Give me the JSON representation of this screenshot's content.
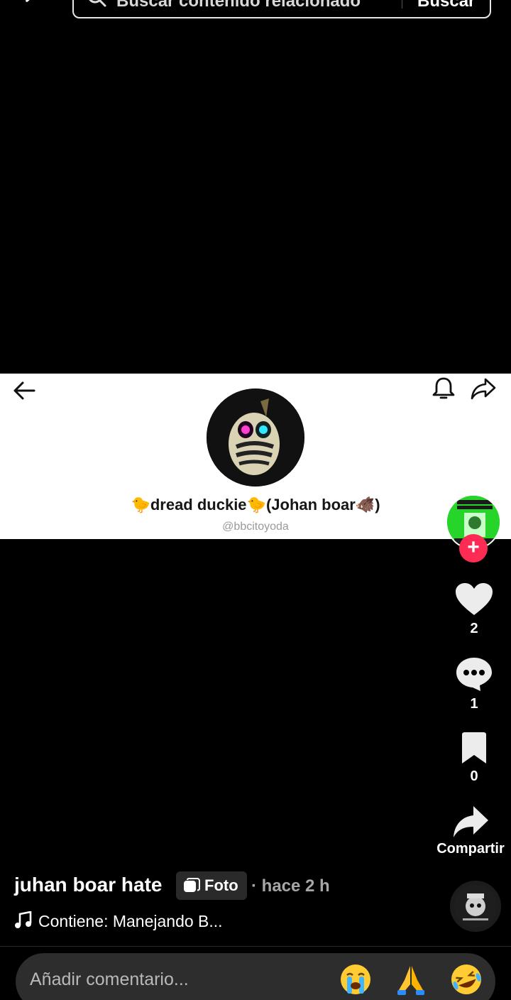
{
  "search": {
    "placeholder": "Buscar contenido relacionado",
    "button_label": "Buscar"
  },
  "photo_post": {
    "profile_name": "🐤dread duckie🐤(Johan boar🐗)",
    "profile_handle": "@bbcitoyoda"
  },
  "actions": {
    "likes": "2",
    "comments": "1",
    "saves": "0",
    "share_label": "Compartir"
  },
  "caption": {
    "title": "juhan boar hate",
    "badge_label": "Foto",
    "time": "· hace 2 h",
    "music": "Contiene: Manejando B..."
  },
  "comment_bar": {
    "placeholder": "Añadir comentario...",
    "emojis": [
      "😭",
      "🙏",
      "🤣"
    ]
  },
  "colors": {
    "background": "#000000",
    "follow_button": "#fe2c55",
    "creator_avatar": "#27d52a"
  }
}
